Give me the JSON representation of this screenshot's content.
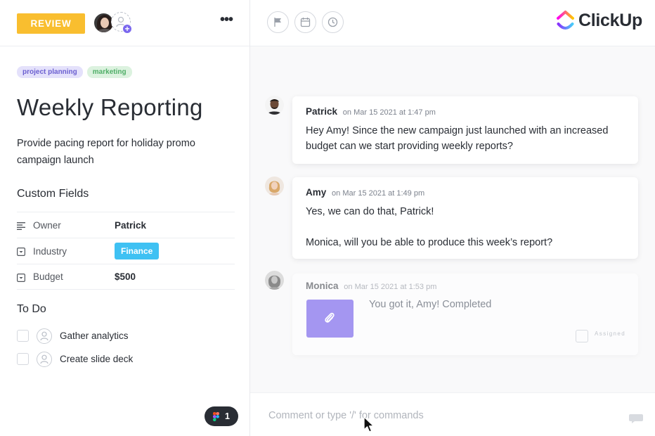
{
  "task": {
    "status_label": "REVIEW",
    "tags": [
      "project planning",
      "marketing"
    ],
    "title": "Weekly Reporting",
    "description": "Provide pacing report for holiday promo campaign launch",
    "more_label": "•••"
  },
  "custom_fields": {
    "heading": "Custom Fields",
    "rows": [
      {
        "label": "Owner",
        "value": "Patrick",
        "icon": "text-lines-icon"
      },
      {
        "label": "Industry",
        "value": "Finance",
        "icon": "dropdown-field-icon"
      },
      {
        "label": "Budget",
        "value": "$500",
        "icon": "dropdown-field-icon"
      }
    ]
  },
  "todo": {
    "heading": "To Do",
    "items": [
      {
        "label": "Gather analytics",
        "checked": false
      },
      {
        "label": "Create slide deck",
        "checked": false
      }
    ]
  },
  "figma_badge": {
    "count": "1"
  },
  "header": {
    "brand": "ClickUp",
    "actions": [
      "flag-icon",
      "calendar-icon",
      "clock-icon"
    ]
  },
  "comments": [
    {
      "author": "Patrick",
      "time": "on Mar 15 2021 at 1:47 pm",
      "body": "Hey Amy! Since the new campaign just launched with an increased budget can we start providing weekly reports?"
    },
    {
      "author": "Amy",
      "time": "on Mar 15 2021 at 1:49 pm",
      "body_line1": "Yes, we can do that, Patrick!",
      "body_line2": "Monica, will you be able to produce this week’s report?"
    },
    {
      "author": "Monica",
      "time": "on Mar 15 2021 at 1:53 pm",
      "body": "You got it, Amy! Completed",
      "assign_label": "Assigned"
    }
  ],
  "comment_box": {
    "placeholder": "Comment or type '/' for commands"
  },
  "colors": {
    "review": "#f9be2f",
    "tag_project_planning": "#6b5fd0",
    "tag_marketing": "#4fae67",
    "finance_chip": "#3fc1f3",
    "attachment": "#a496f1",
    "accent": "#7b68ee"
  }
}
